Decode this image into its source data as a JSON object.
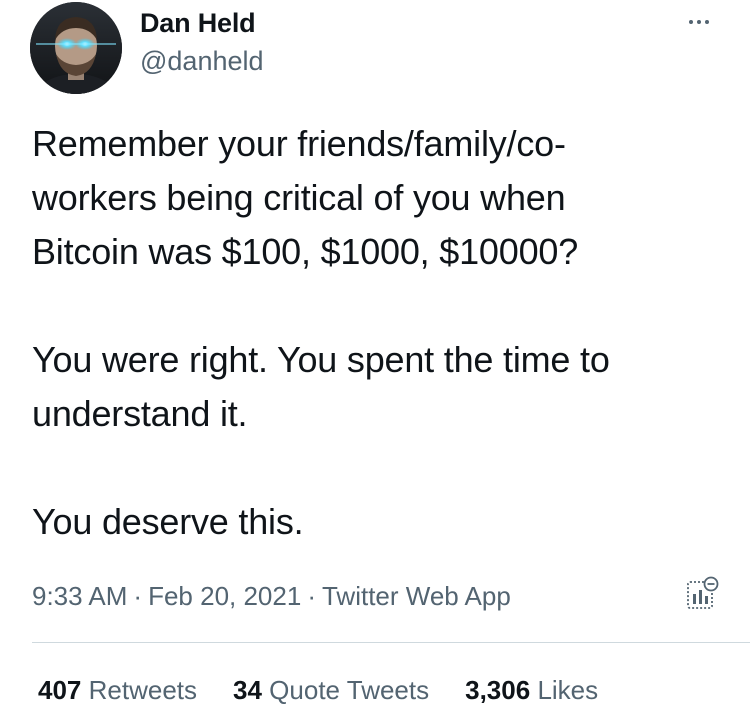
{
  "author": {
    "display_name": "Dan Held",
    "handle": "@danheld"
  },
  "tweet": {
    "paragraphs": [
      "Remember your friends/family/co-\nworkers being critical of you when\nBitcoin was $100, $1000, $10000?",
      "You were right. You spent the time to\nunderstand it.",
      "You deserve this."
    ]
  },
  "meta": {
    "time": "9:33 AM",
    "date": "Feb 20, 2021",
    "source": "Twitter Web App",
    "separator": "·"
  },
  "stats": {
    "retweets_count": "407",
    "retweets_label": "Retweets",
    "quotes_count": "34",
    "quotes_label": "Quote Tweets",
    "likes_count": "3,306",
    "likes_label": "Likes"
  },
  "colors": {
    "text_primary": "#0f1419",
    "text_secondary": "#536471",
    "divider": "#cfd9de",
    "avatar_eye_glow": "#2fd3ff"
  },
  "icons": {
    "more": "more-dots-icon",
    "analytics": "analytics-icon"
  }
}
